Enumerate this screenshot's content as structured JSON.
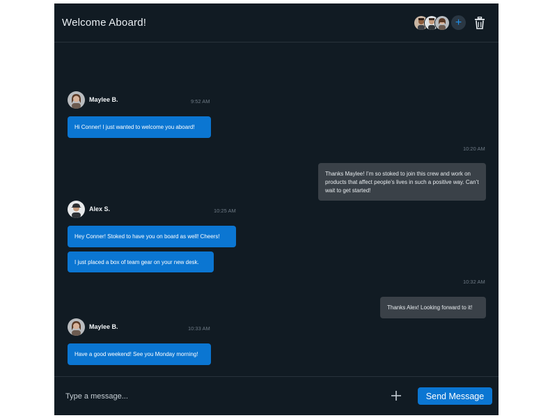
{
  "header": {
    "title": "Welcome Aboard!",
    "members": [
      "avatar-1",
      "avatar-2",
      "avatar-3"
    ],
    "add_member_icon": "+",
    "delete_icon": "trash-icon"
  },
  "messages": [
    {
      "sender": "Maylee B.",
      "time": "9:52 AM",
      "text": "Hi Conner! I just wanted to welcome you aboard!"
    },
    {
      "time": "10:20 AM",
      "text": "Thanks Maylee! I’m so stoked to join this crew and work on products that affect people’s lives in such a positive way. Can’t wait to get started!"
    },
    {
      "sender": "Alex S.",
      "time": "10:25 AM",
      "text": "Hey Conner! Stoked to have you on board as well! Cheers!"
    },
    {
      "text": "I just placed a box of team gear on your new desk."
    },
    {
      "time": "10:32 AM",
      "text": "Thanks Alex! Looking forward to it!"
    },
    {
      "sender": "Maylee B.",
      "time": "10:33 AM",
      "text": "Have a good weekend! See you Monday morning!"
    }
  ],
  "composer": {
    "placeholder": "Type a message...",
    "send_label": "Send Message"
  },
  "colors": {
    "panel_bg": "#111b23",
    "incoming_bubble": "#0b76d2",
    "outgoing_bubble": "#3a4148",
    "accent": "#0b76d2"
  }
}
